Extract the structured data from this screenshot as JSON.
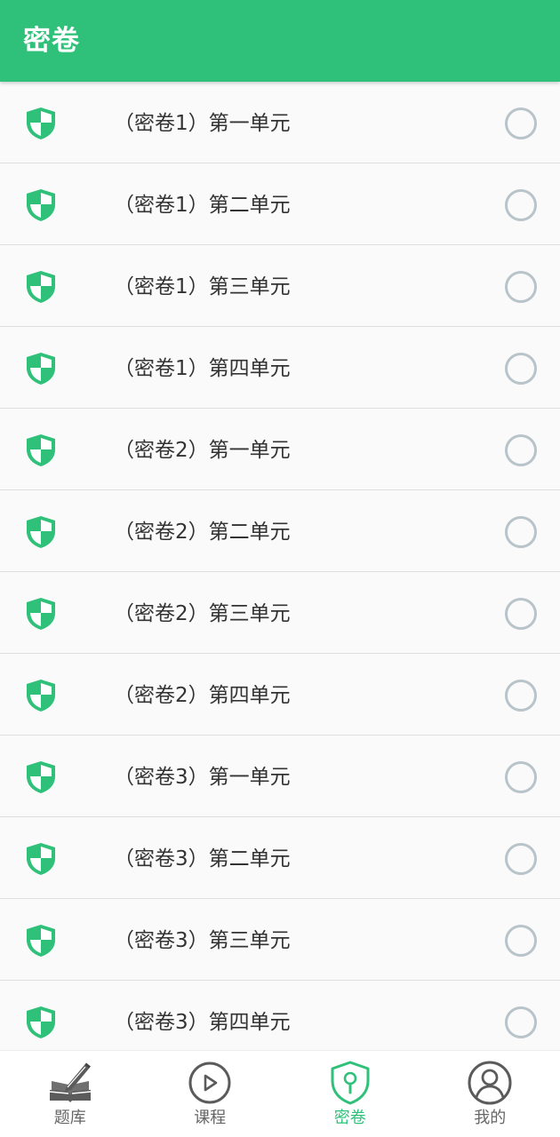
{
  "colors": {
    "primary": "#2fc17a",
    "radio_border": "#b8c3ca",
    "text_dark": "#333333",
    "text_muted": "#666666"
  },
  "app_bar": {
    "title": "密卷"
  },
  "papers": [
    {
      "title": "（密卷1）第一单元",
      "selected": false,
      "icon": "shield-icon"
    },
    {
      "title": "（密卷1）第二单元",
      "selected": false,
      "icon": "shield-icon"
    },
    {
      "title": "（密卷1）第三单元",
      "selected": false,
      "icon": "shield-icon"
    },
    {
      "title": "（密卷1）第四单元",
      "selected": false,
      "icon": "shield-icon"
    },
    {
      "title": "（密卷2）第一单元",
      "selected": false,
      "icon": "shield-icon"
    },
    {
      "title": "（密卷2）第二单元",
      "selected": false,
      "icon": "shield-icon"
    },
    {
      "title": "（密卷2）第三单元",
      "selected": false,
      "icon": "shield-icon"
    },
    {
      "title": "（密卷2）第四单元",
      "selected": false,
      "icon": "shield-icon"
    },
    {
      "title": "（密卷3）第一单元",
      "selected": false,
      "icon": "shield-icon"
    },
    {
      "title": "（密卷3）第二单元",
      "selected": false,
      "icon": "shield-icon"
    },
    {
      "title": "（密卷3）第三单元",
      "selected": false,
      "icon": "shield-icon"
    },
    {
      "title": "（密卷3）第四单元",
      "selected": false,
      "icon": "shield-icon"
    }
  ],
  "bottom_nav": {
    "items": [
      {
        "label": "题库",
        "icon": "book-pen-icon",
        "active": false
      },
      {
        "label": "课程",
        "icon": "play-circle-icon",
        "active": false
      },
      {
        "label": "密卷",
        "icon": "shield-keyhole-icon",
        "active": true
      },
      {
        "label": "我的",
        "icon": "user-circle-icon",
        "active": false
      }
    ]
  }
}
